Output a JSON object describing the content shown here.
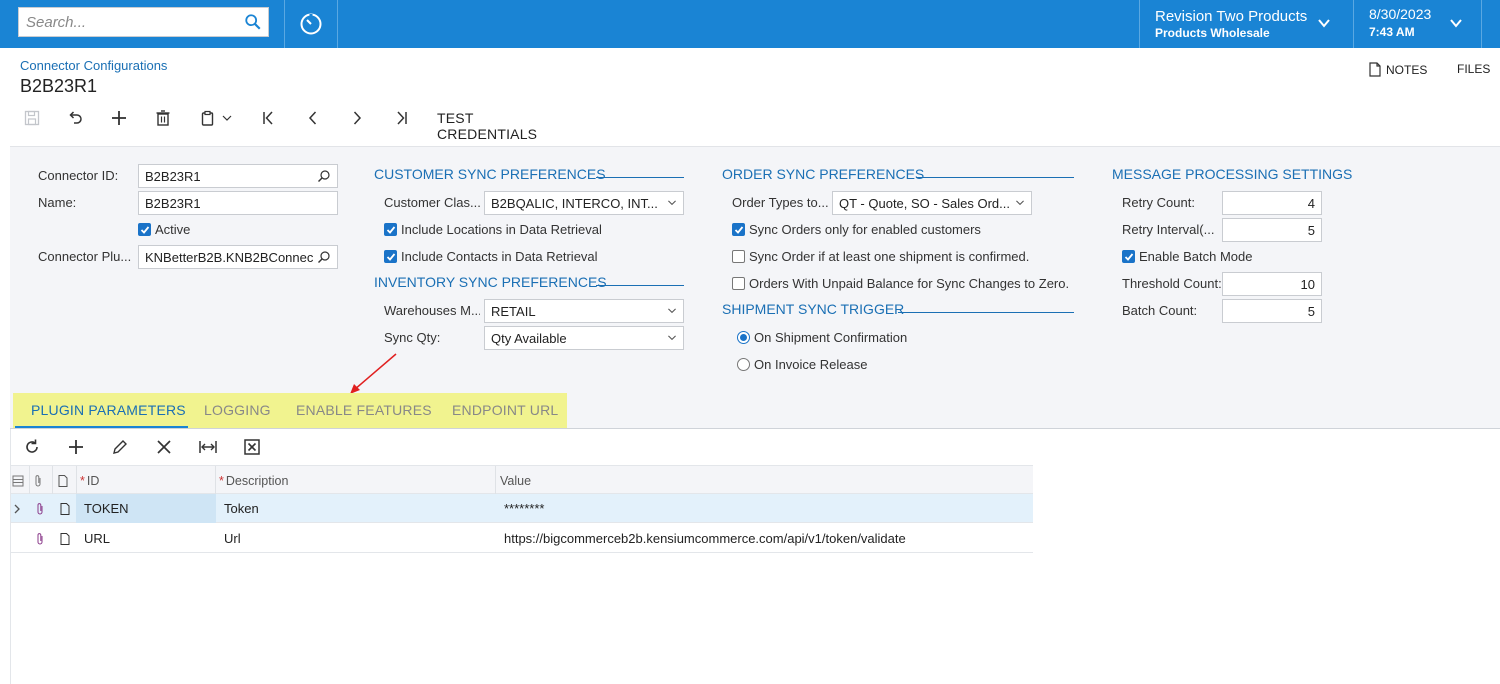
{
  "topbar": {
    "search_placeholder": "Search...",
    "company_line1": "Revision Two Products",
    "company_line2": "Products Wholesale",
    "date": "8/30/2023",
    "time": "7:43 AM"
  },
  "header": {
    "breadcrumb": "Connector Configurations",
    "title": "B2B23R1",
    "notes_label": "NOTES",
    "files_label": "FILES"
  },
  "toolbar": {
    "test_credentials_label": "TEST CREDENTIALS"
  },
  "general": {
    "connector_id_label": "Connector ID:",
    "connector_id_value": "B2B23R1",
    "name_label": "Name:",
    "name_value": "B2B23R1",
    "active_label": "Active",
    "plugin_label": "Connector Plu...",
    "plugin_value": "KNBetterB2B.KNB2BConnect"
  },
  "customer_sync": {
    "heading": "CUSTOMER SYNC PREFERENCES",
    "customer_class_label": "Customer Clas...",
    "customer_class_value": "B2BQALIC, INTERCO, INT...",
    "include_locations_label": "Include Locations in Data Retrieval",
    "include_contacts_label": "Include Contacts in Data Retrieval"
  },
  "inventory_sync": {
    "heading": "INVENTORY SYNC PREFERENCES",
    "warehouses_label": "Warehouses M...",
    "warehouses_value": "RETAIL",
    "sync_qty_label": "Sync Qty:",
    "sync_qty_value": "Qty Available"
  },
  "order_sync": {
    "heading": "ORDER SYNC PREFERENCES",
    "order_types_label": "Order Types to...",
    "order_types_value": "QT - Quote, SO - Sales Ord...",
    "opt1_label": "Sync Orders only for enabled customers",
    "opt2_label": "Sync Order if at least one shipment is confirmed.",
    "opt3_label": "Orders With Unpaid Balance for Sync Changes to Zero."
  },
  "shipment_sync": {
    "heading": "SHIPMENT SYNC TRIGGER",
    "opt1_label": "On Shipment Confirmation",
    "opt2_label": "On Invoice Release"
  },
  "message_processing": {
    "heading": "MESSAGE PROCESSING SETTINGS",
    "retry_count_label": "Retry Count:",
    "retry_count_value": "4",
    "retry_interval_label": "Retry Interval(...",
    "retry_interval_value": "5",
    "batch_mode_label": "Enable Batch Mode",
    "threshold_label": "Threshold Count:",
    "threshold_value": "10",
    "batch_count_label": "Batch Count:",
    "batch_count_value": "5"
  },
  "tabs": {
    "tab1": "PLUGIN PARAMETERS",
    "tab2": "LOGGING",
    "tab3": "ENABLE FEATURES",
    "tab4": "ENDPOINT URL"
  },
  "grid": {
    "col_id": "ID",
    "col_description": "Description",
    "col_value": "Value",
    "rows": [
      {
        "id": "TOKEN",
        "description": "Token",
        "value": "********"
      },
      {
        "id": "URL",
        "description": "Url",
        "value": "https://bigcommerceb2b.kensiumcommerce.com/api/v1/token/validate"
      }
    ]
  },
  "colors": {
    "topbar": "#1a84d4",
    "accent": "#1a6fb4",
    "tab_highlight": "#f1f38f",
    "annotation_arrow": "#e02020"
  }
}
